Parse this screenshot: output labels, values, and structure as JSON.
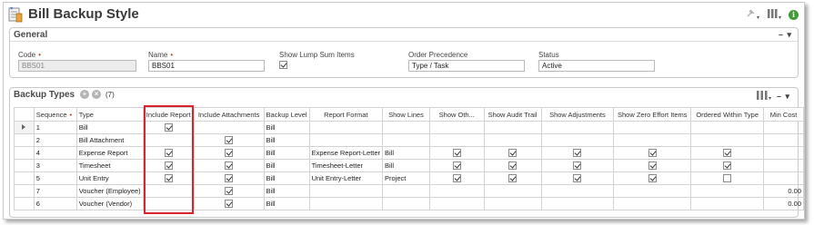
{
  "header": {
    "title": "Bill Backup Style",
    "info_glyph": "i",
    "icons": [
      "bill-backup-style-icon",
      "pin-icon",
      "columns-icon",
      "info-icon"
    ]
  },
  "general": {
    "title": "General",
    "collapse": "– ▾",
    "fields": {
      "code": {
        "label": "Code",
        "required": "•",
        "value": "BBS01"
      },
      "name": {
        "label": "Name",
        "required": "•",
        "value": "BBS01"
      },
      "lump": {
        "label": "Show Lump Sum Items",
        "checked": true
      },
      "order": {
        "label": "Order Precedence",
        "value": "Type / Task"
      },
      "status": {
        "label": "Status",
        "value": "Active"
      }
    }
  },
  "backup_types": {
    "title": "Backup Types",
    "add_glyph": "+",
    "remove_glyph": "×",
    "count": "(7)",
    "collapse": "– ▾",
    "columns": [
      "Sequence",
      "Type",
      "Include Report",
      "Include Attachments",
      "Backup Level",
      "Report Format",
      "Show Lines",
      "Show Oth...",
      "Show Audit Trail",
      "Show Adjustments",
      "Show Zero Effort Items",
      "Ordered Within Type",
      "Min Cost"
    ],
    "sequence_required": "•",
    "rows": [
      {
        "seq": "1",
        "type": "Bill",
        "report": true,
        "attach": false,
        "level": "Bill",
        "format": "",
        "lines": "",
        "oth": false,
        "audit": false,
        "adj": false,
        "zero": false,
        "ordered": false,
        "ordered_box": false,
        "min": ""
      },
      {
        "seq": "2",
        "type": "Bill Attachment",
        "report": false,
        "attach": true,
        "level": "Bill",
        "format": "",
        "lines": "",
        "oth": false,
        "audit": false,
        "adj": false,
        "zero": false,
        "ordered": false,
        "ordered_box": false,
        "min": ""
      },
      {
        "seq": "4",
        "type": "Expense Report",
        "report": true,
        "attach": true,
        "level": "Bill",
        "format": "Expense Report-Letter",
        "lines": "Bill",
        "oth": true,
        "audit": true,
        "adj": true,
        "zero": true,
        "ordered": true,
        "ordered_box": true,
        "min": ""
      },
      {
        "seq": "3",
        "type": "Timesheet",
        "report": true,
        "attach": true,
        "level": "Bill",
        "format": "Timesheet-Letter",
        "lines": "Bill",
        "oth": true,
        "audit": true,
        "adj": true,
        "zero": true,
        "ordered": true,
        "ordered_box": true,
        "min": ""
      },
      {
        "seq": "5",
        "type": "Unit Entry",
        "report": true,
        "attach": true,
        "level": "Bill",
        "format": "Unit Entry-Letter",
        "lines": "Project",
        "oth": true,
        "audit": true,
        "adj": true,
        "zero": true,
        "ordered": false,
        "ordered_box": true,
        "min": ""
      },
      {
        "seq": "7",
        "type": "Voucher (Employee)",
        "report": false,
        "attach": true,
        "level": "Bill",
        "format": "",
        "lines": "",
        "oth": false,
        "audit": false,
        "adj": false,
        "zero": false,
        "ordered": false,
        "ordered_box": false,
        "min": "0.00"
      },
      {
        "seq": "6",
        "type": "Voucher (Vendor)",
        "report": false,
        "attach": true,
        "level": "Bill",
        "format": "",
        "lines": "",
        "oth": false,
        "audit": false,
        "adj": false,
        "zero": false,
        "ordered": false,
        "ordered_box": false,
        "min": "0.00"
      }
    ]
  },
  "colors": {
    "highlight": "#d9232d",
    "info": "#3f9c35",
    "required": "#c0392b"
  }
}
